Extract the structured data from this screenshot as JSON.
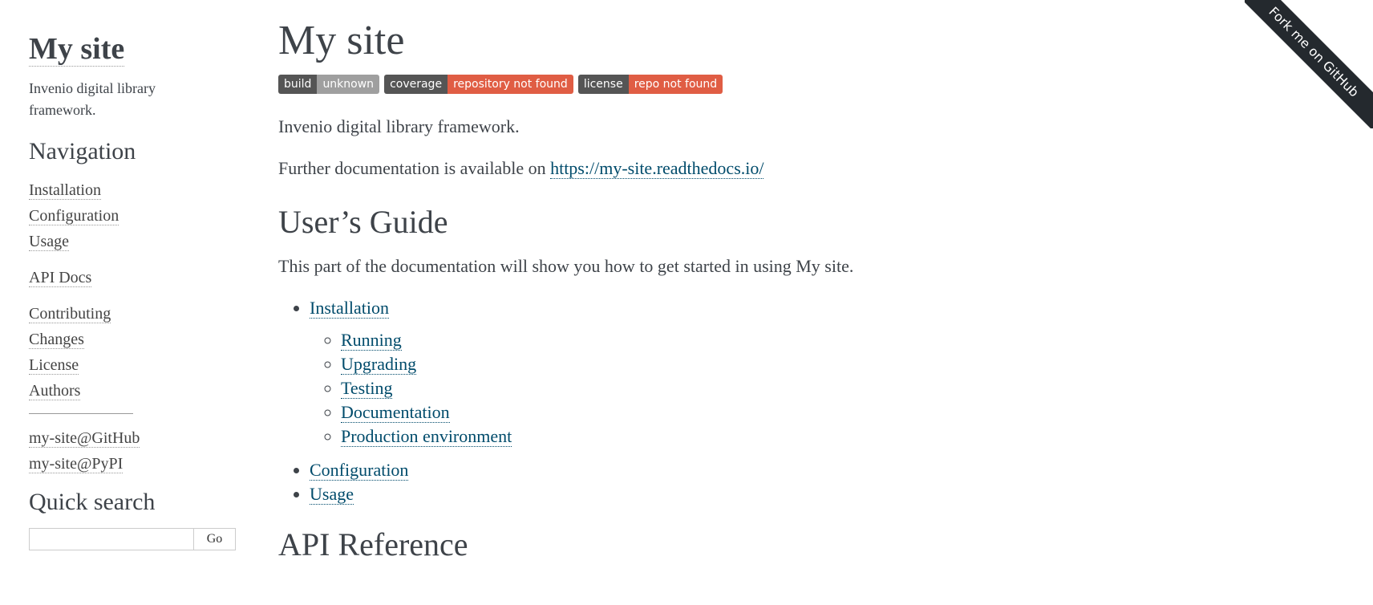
{
  "sidebar": {
    "logo": "My site",
    "tagline": "Invenio digital library framework.",
    "navigation_heading": "Navigation",
    "nav_group1": [
      "Installation",
      "Configuration",
      "Usage"
    ],
    "nav_group2": [
      "API Docs"
    ],
    "nav_group3": [
      "Contributing",
      "Changes",
      "License",
      "Authors"
    ],
    "external_links": [
      "my-site@GitHub",
      "my-site@PyPI"
    ],
    "search_heading": "Quick search",
    "search_value": "",
    "search_button": "Go"
  },
  "main": {
    "title": "My site",
    "badges": [
      {
        "label": "build",
        "value": "unknown",
        "color": "#9f9f9f"
      },
      {
        "label": "coverage",
        "value": "repository not found",
        "color": "#e05d44"
      },
      {
        "label": "license",
        "value": "repo not found",
        "color": "#e05d44"
      }
    ],
    "intro": "Invenio digital library framework.",
    "doc_prefix": "Further documentation is available on ",
    "doc_link": "https://my-site.readthedocs.io/",
    "users_guide_heading": "User’s Guide",
    "users_guide_text": "This part of the documentation will show you how to get started in using My site.",
    "guide_items": [
      {
        "label": "Installation",
        "children": [
          "Running",
          "Upgrading",
          "Testing",
          "Documentation",
          "Production environment"
        ]
      },
      {
        "label": "Configuration",
        "children": []
      },
      {
        "label": "Usage",
        "children": []
      }
    ],
    "api_heading": "API Reference"
  },
  "ribbon": {
    "text": "Fork me on GitHub",
    "color": "#24292e"
  }
}
